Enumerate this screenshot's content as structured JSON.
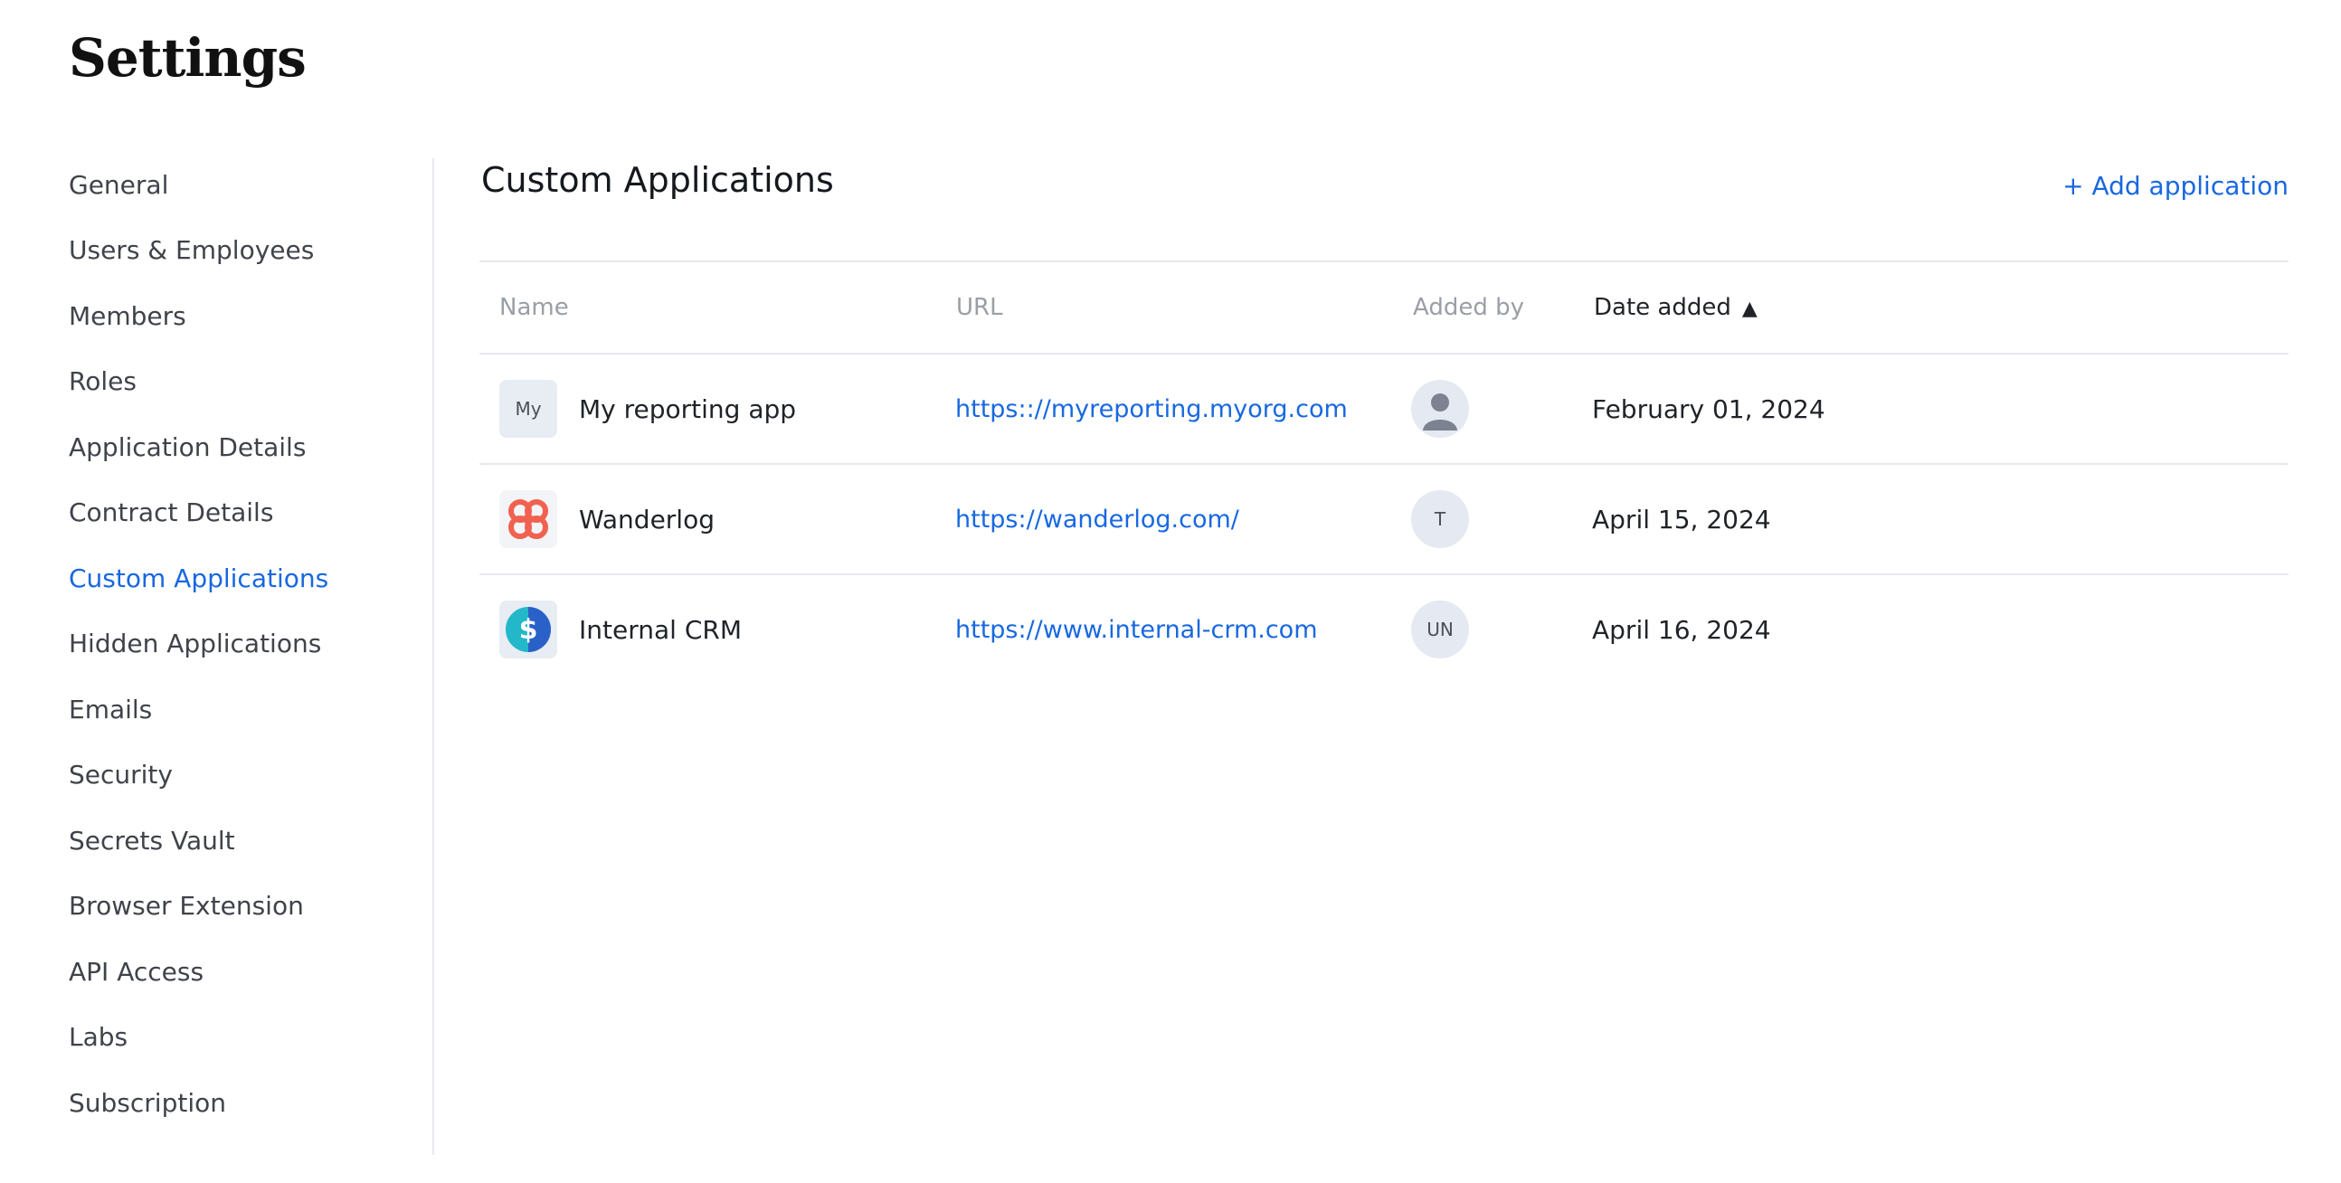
{
  "page": {
    "title": "Settings"
  },
  "sidebar": {
    "items": [
      {
        "label": "General",
        "active": false
      },
      {
        "label": "Users & Employees",
        "active": false
      },
      {
        "label": "Members",
        "active": false
      },
      {
        "label": "Roles",
        "active": false
      },
      {
        "label": "Application Details",
        "active": false
      },
      {
        "label": "Contract Details",
        "active": false
      },
      {
        "label": "Custom Applications",
        "active": true
      },
      {
        "label": "Hidden Applications",
        "active": false
      },
      {
        "label": "Emails",
        "active": false
      },
      {
        "label": "Security",
        "active": false
      },
      {
        "label": "Secrets Vault",
        "active": false
      },
      {
        "label": "Browser Extension",
        "active": false
      },
      {
        "label": "API Access",
        "active": false
      },
      {
        "label": "Labs",
        "active": false
      },
      {
        "label": "Subscription",
        "active": false
      }
    ]
  },
  "main": {
    "title": "Custom Applications",
    "add_label": "+ Add application",
    "table": {
      "headers": {
        "name": "Name",
        "url": "URL",
        "added_by": "Added by",
        "date_added": "Date added",
        "sort_indicator": "▲"
      },
      "rows": [
        {
          "icon": "my-initials-icon",
          "icon_text": "My",
          "name": "My reporting app",
          "url": "https:://myreporting.myorg.com",
          "added_by": {
            "type": "person-icon",
            "initials": ""
          },
          "date": "February 01, 2024"
        },
        {
          "icon": "wanderlog-logo-icon",
          "icon_color": "#f0624f",
          "name": "Wanderlog",
          "url": "https://wanderlog.com/",
          "added_by": {
            "type": "initials",
            "initials": "T"
          },
          "date": "April 15, 2024"
        },
        {
          "icon": "dollar-logo-icon",
          "icon_color": "#22b8c9",
          "name": "Internal CRM",
          "url": "https://www.internal-crm.com",
          "added_by": {
            "type": "initials",
            "initials": "UN"
          },
          "date": "April 16, 2024"
        }
      ]
    }
  },
  "colors": {
    "accent": "#1868e0",
    "divider": "#e7e9ee",
    "header_text": "#9a9ea6"
  }
}
